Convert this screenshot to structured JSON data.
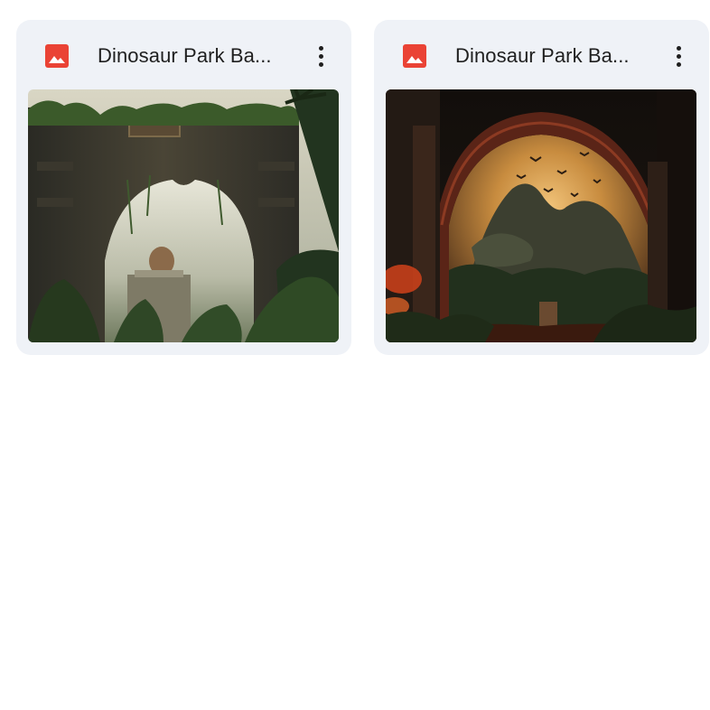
{
  "files": [
    {
      "title": "Dinosaur Park Ba...",
      "icon": "image-file-icon",
      "icon_color": "#ea4335",
      "more_icon": "more-vert-icon",
      "thumbnail": "jungle-stone-archway-thumbnail"
    },
    {
      "title": "Dinosaur Park Ba...",
      "icon": "image-file-icon",
      "icon_color": "#ea4335",
      "more_icon": "more-vert-icon",
      "thumbnail": "dinosaur-archway-sunset-thumbnail"
    }
  ],
  "colors": {
    "card_background": "#eff2f7",
    "title_text": "#1f1f1f",
    "page_background": "#ffffff"
  }
}
